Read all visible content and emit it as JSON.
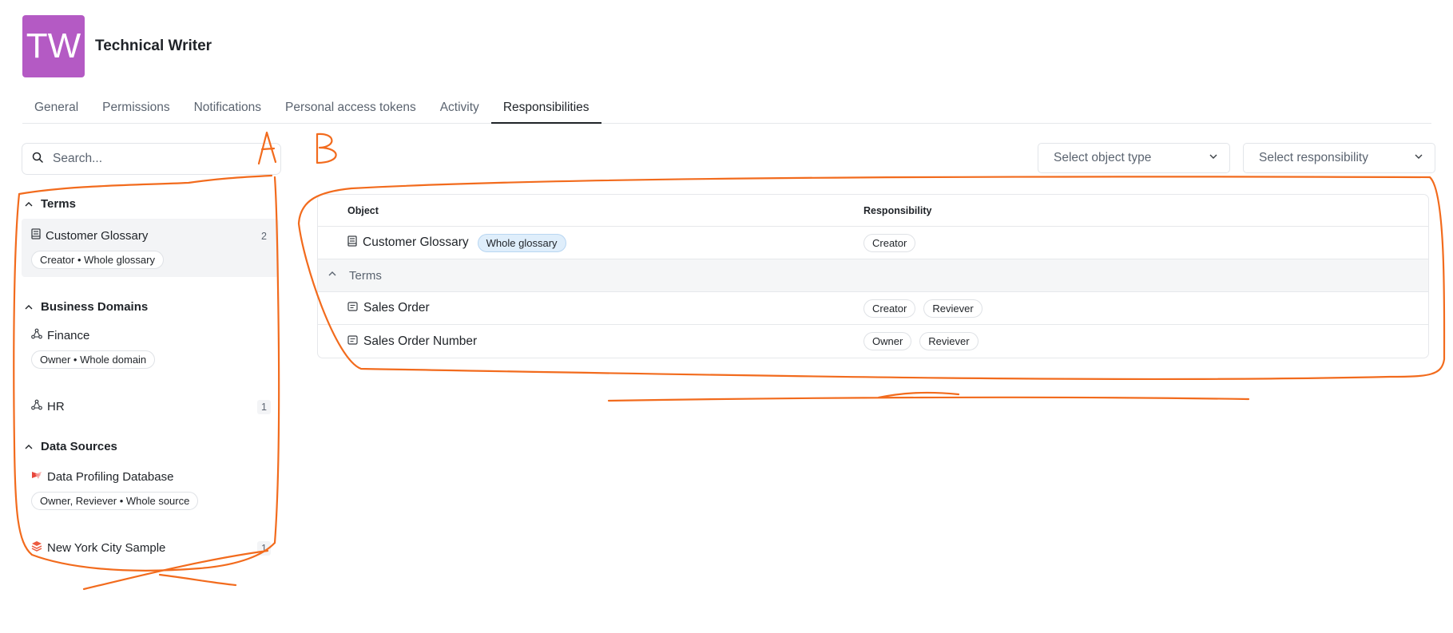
{
  "header": {
    "avatar_initials": "TW",
    "title": "Technical Writer",
    "avatar_color": "#b45ac4"
  },
  "tabs": [
    {
      "label": "General"
    },
    {
      "label": "Permissions"
    },
    {
      "label": "Notifications"
    },
    {
      "label": "Personal access tokens"
    },
    {
      "label": "Activity"
    },
    {
      "label": "Responsibilities",
      "active": true
    }
  ],
  "search": {
    "placeholder": "Search..."
  },
  "filters": {
    "object_type_placeholder": "Select object type",
    "responsibility_placeholder": "Select responsibility"
  },
  "sidebar": {
    "sections": [
      {
        "label": "Terms",
        "items": [
          {
            "name": "Customer Glossary",
            "icon": "glossary-icon",
            "count": "2",
            "pill": "Creator • Whole glossary",
            "selected": true
          }
        ]
      },
      {
        "label": "Business Domains",
        "items": [
          {
            "name": "Finance",
            "icon": "domain-icon",
            "pill": "Owner • Whole domain"
          },
          {
            "name": "HR",
            "icon": "domain-icon",
            "count": "1"
          }
        ]
      },
      {
        "label": "Data Sources",
        "items": [
          {
            "name": "Data Profiling Database",
            "icon": "datasource-icon",
            "pill": "Owner, Reviever • Whole source"
          },
          {
            "name": "New York City Sample",
            "icon": "datasource-stack-icon",
            "count": "1"
          }
        ]
      }
    ]
  },
  "table": {
    "headers": {
      "object": "Object",
      "responsibility": "Responsibility"
    },
    "rows": [
      {
        "object": "Customer Glossary",
        "tag": "Whole glossary",
        "responsibilities": [
          "Creator"
        ]
      },
      {
        "group": "Terms"
      },
      {
        "object": "Sales Order",
        "responsibilities": [
          "Creator",
          "Reviever"
        ]
      },
      {
        "object": "Sales Order Number",
        "responsibilities": [
          "Owner",
          "Reviever"
        ]
      }
    ]
  },
  "annotations": {
    "label_a": "A",
    "label_b": "B",
    "stroke_color": "#f26b1d"
  }
}
